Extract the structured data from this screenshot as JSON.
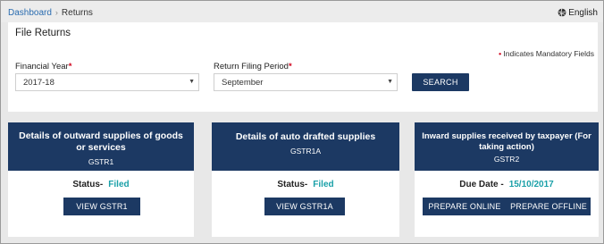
{
  "breadcrumb": {
    "home": "Dashboard",
    "separator": "›",
    "current": "Returns"
  },
  "language": {
    "label": "English",
    "icon": "globe-icon"
  },
  "panel": {
    "title": "File Returns",
    "mandatory_marker": "•",
    "mandatory_note": "Indicates Mandatory Fields",
    "financial_year": {
      "label": "Financial Year",
      "required": "*",
      "value": "2017-18"
    },
    "return_period": {
      "label": "Return Filing Period",
      "required": "*",
      "value": "September"
    },
    "search_label": "SEARCH"
  },
  "cards": [
    {
      "title": "Details of outward supplies of goods or services",
      "subtitle": "GSTR1",
      "status_label": "Status-",
      "status_value": "Filed",
      "button": "VIEW GSTR1"
    },
    {
      "title": "Details of auto drafted supplies",
      "subtitle": "GSTR1A",
      "status_label": "Status-",
      "status_value": "Filed",
      "button": "VIEW GSTR1A"
    },
    {
      "title": "Inward supplies received by taxpayer (For taking action)",
      "subtitle": "GSTR2",
      "due_label": "Due Date -",
      "due_value": "15/10/2017",
      "button_online": "PREPARE ONLINE",
      "button_offline": "PREPARE OFFLINE"
    }
  ],
  "colors": {
    "primary": "#1c3963",
    "accent": "#1aa0a8",
    "required": "#d0021b",
    "link": "#2a6cb0"
  }
}
